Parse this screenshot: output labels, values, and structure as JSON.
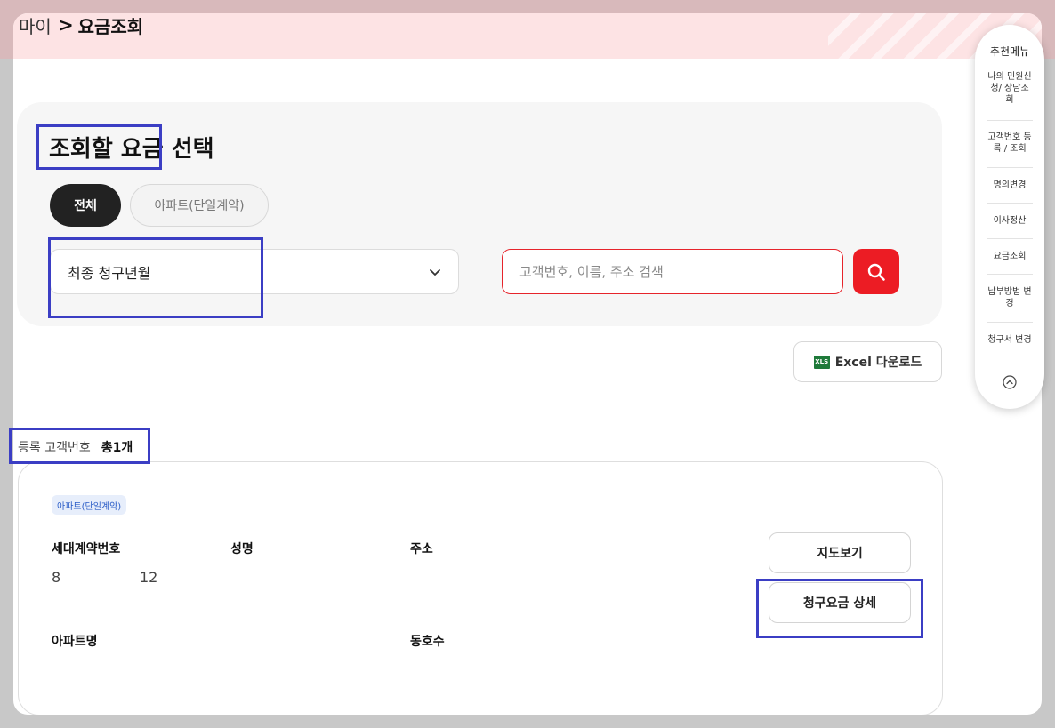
{
  "breadcrumb": {
    "parent": "마이",
    "separator": ">",
    "current": "요금조회"
  },
  "section": {
    "title": "조회할 요금 선택",
    "tabs": [
      {
        "label": "전체"
      },
      {
        "label": "아파트(단일계약)"
      }
    ],
    "dropdown": {
      "value": "최종 청구년월"
    },
    "search": {
      "placeholder": "고객번호, 이름, 주소 검색"
    }
  },
  "excel": {
    "icon_text": "XLS",
    "label": "Excel 다운로드"
  },
  "registered": {
    "label": "등록 고객번호",
    "count": "총1개"
  },
  "card": {
    "badge": "아파트(단일계약)",
    "contract_label": "세대계약번호",
    "contract_value_a": "8",
    "contract_value_b": "12",
    "name_label": "성명",
    "address_label": "주소",
    "apartment_label": "아파트명",
    "unit_label": "동호수",
    "map_button": "지도보기",
    "detail_button": "청구요금 상세"
  },
  "quick_menu": {
    "title": "추천메뉴",
    "items": [
      {
        "label": "나의 민원신청/ 상담조회"
      },
      {
        "label": "고객번호 등록 / 조회"
      },
      {
        "label": "명의변경"
      },
      {
        "label": "이사정산"
      },
      {
        "label": "요금조회"
      },
      {
        "label": "납부방법 변경"
      },
      {
        "label": "청구서 변경"
      }
    ]
  },
  "colors": {
    "accent_red": "#ec1c24",
    "highlight": "#3b3ec4",
    "badge_blue": "#2a5cc7"
  }
}
